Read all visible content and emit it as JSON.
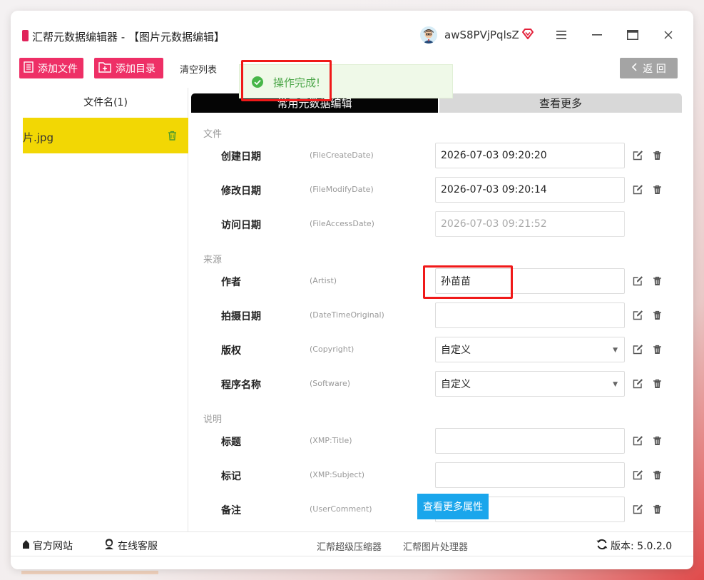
{
  "window": {
    "title": "汇帮元数据编辑器 - 【图片元数据编辑】",
    "username": "awS8PVjPqlsZ"
  },
  "toolbar": {
    "add_file_label": "添加文件",
    "add_dir_label": "添加目录",
    "clear_label": "清空列表",
    "back_label": "返 回"
  },
  "toast": {
    "message": "操作完成!"
  },
  "file_panel": {
    "header": "文件名(1)",
    "files": [
      {
        "name": "片.jpg"
      }
    ]
  },
  "tabs": {
    "common": "常用元数据编辑",
    "more": "查看更多"
  },
  "sections": {
    "file": "文件",
    "source": "来源",
    "description": "说明"
  },
  "rows": [
    {
      "label": "创建日期",
      "key": "(FileCreateDate)",
      "value": "2026-07-03 09:20:20",
      "type": "text"
    },
    {
      "label": "修改日期",
      "key": "(FileModifyDate)",
      "value": "2026-07-03 09:20:14",
      "type": "text"
    },
    {
      "label": "访问日期",
      "key": "(FileAccessDate)",
      "value": "2026-07-03 09:21:52",
      "type": "disabled"
    },
    {
      "label": "作者",
      "key": "(Artist)",
      "value": "孙苗苗",
      "type": "text"
    },
    {
      "label": "拍摄日期",
      "key": "(DateTimeOriginal)",
      "value": "",
      "type": "text"
    },
    {
      "label": "版权",
      "key": "(Copyright)",
      "value": "自定义",
      "type": "select"
    },
    {
      "label": "程序名称",
      "key": "(Software)",
      "value": "自定义",
      "type": "select"
    },
    {
      "label": "标题",
      "key": "(XMP:Title)",
      "value": "",
      "type": "text"
    },
    {
      "label": "标记",
      "key": "(XMP:Subject)",
      "value": "",
      "type": "text"
    },
    {
      "label": "备注",
      "key": "(UserComment)",
      "value": "",
      "type": "text"
    }
  ],
  "more_props_button": "查看更多属性",
  "footer": {
    "website": "官方网站",
    "support": "在线客服",
    "compressor": "汇帮超级压缩器",
    "image_tool": "汇帮图片处理器",
    "version": "版本: 5.0.2.0"
  },
  "colors": {
    "accent_pink": "#ee2f66",
    "selected_file": "#f2d704",
    "toast_green": "#47b649",
    "highlight_red": "#f01919",
    "blue_button": "#1aa6ec"
  },
  "icons": {
    "titlebar": [
      "avatar",
      "vip-icon",
      "menu-icon",
      "minimize-icon",
      "maximize-icon",
      "close-icon"
    ],
    "row_actions": [
      "edit-icon",
      "trash-icon"
    ]
  }
}
